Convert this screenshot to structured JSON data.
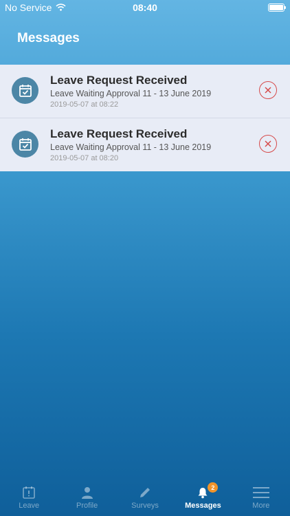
{
  "status_bar": {
    "carrier": "No Service",
    "time": "08:40"
  },
  "header": {
    "title": "Messages"
  },
  "messages": [
    {
      "title": "Leave Request Received",
      "subtitle": "Leave Waiting Approval 11 - 13 June 2019",
      "timestamp": "2019-05-07 at 08:22",
      "icon": "calendar-check-icon"
    },
    {
      "title": "Leave Request Received",
      "subtitle": "Leave Waiting Approval 11 - 13 June 2019",
      "timestamp": "2019-05-07 at 08:20",
      "icon": "calendar-check-icon"
    }
  ],
  "tabbar": {
    "tabs": [
      {
        "label": "Leave",
        "icon": "calendar-alert-icon",
        "active": false
      },
      {
        "label": "Profile",
        "icon": "person-icon",
        "active": false
      },
      {
        "label": "Surveys",
        "icon": "pencil-icon",
        "active": false
      },
      {
        "label": "Messages",
        "icon": "bell-icon",
        "active": true,
        "badge": "2"
      },
      {
        "label": "More",
        "icon": "menu-icon",
        "active": false
      }
    ]
  },
  "colors": {
    "accent": "#f0942b",
    "delete": "#d64a4a",
    "icon_circle": "#4c86a6",
    "list_bg": "#e8ecf6"
  }
}
